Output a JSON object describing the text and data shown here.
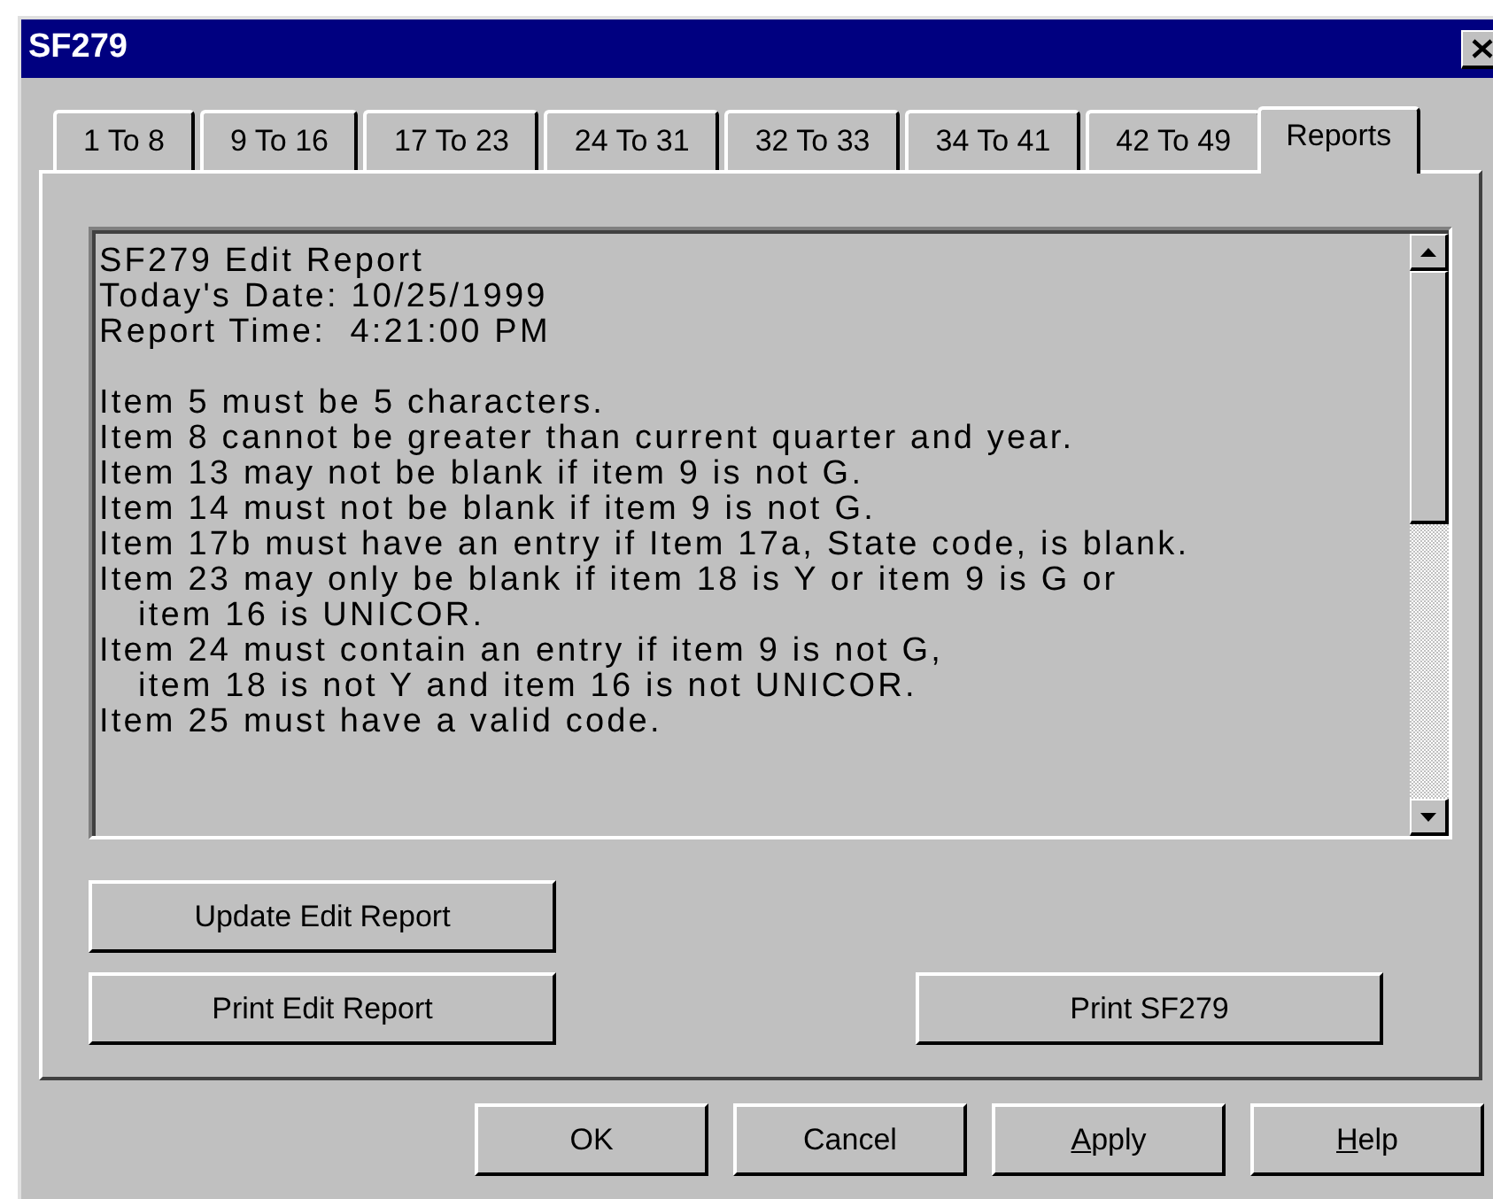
{
  "window": {
    "title": "SF279"
  },
  "tabs": [
    {
      "label": "1 To 8",
      "selected": false
    },
    {
      "label": "9 To 16",
      "selected": false
    },
    {
      "label": "17 To 23",
      "selected": false
    },
    {
      "label": "24 To 31",
      "selected": false
    },
    {
      "label": "32 To 33",
      "selected": false
    },
    {
      "label": "34 To 41",
      "selected": false
    },
    {
      "label": "42 To 49",
      "selected": false
    },
    {
      "label": "Reports",
      "selected": true
    }
  ],
  "report": {
    "header": [
      "SF279 Edit Report",
      "Today's Date: 10/25/1999",
      "Report Time:  4:21:00 PM"
    ],
    "messages": [
      {
        "lines": [
          "Item 5 must be 5 characters."
        ]
      },
      {
        "lines": [
          "Item 8 cannot be greater than current quarter and year."
        ]
      },
      {
        "lines": [
          "Item 13 may not be blank if item 9 is not G."
        ]
      },
      {
        "lines": [
          "Item 14 must not be blank if item 9 is not G."
        ]
      },
      {
        "lines": [
          "Item 17b must have an entry if Item 17a, State code, is blank."
        ]
      },
      {
        "lines": [
          "Item 23 may only be blank if item 18 is Y or item 9 is G or",
          "item 16 is UNICOR."
        ]
      },
      {
        "lines": [
          "Item 24 must contain an entry if item 9 is not G,",
          "item 18 is not Y and item 16 is not UNICOR."
        ]
      },
      {
        "lines": [
          "Item 25 must have a valid code."
        ]
      }
    ]
  },
  "report_buttons": [
    {
      "label": "Update Edit Report"
    },
    {
      "label": "Print Edit Report"
    },
    {
      "label": "Print SF279"
    }
  ],
  "dialog_buttons": [
    {
      "label": "OK",
      "mnemonic": false
    },
    {
      "label": "Cancel",
      "mnemonic": false
    },
    {
      "label": "Apply",
      "mnemonic": true
    },
    {
      "label": "Help",
      "mnemonic": true
    }
  ]
}
